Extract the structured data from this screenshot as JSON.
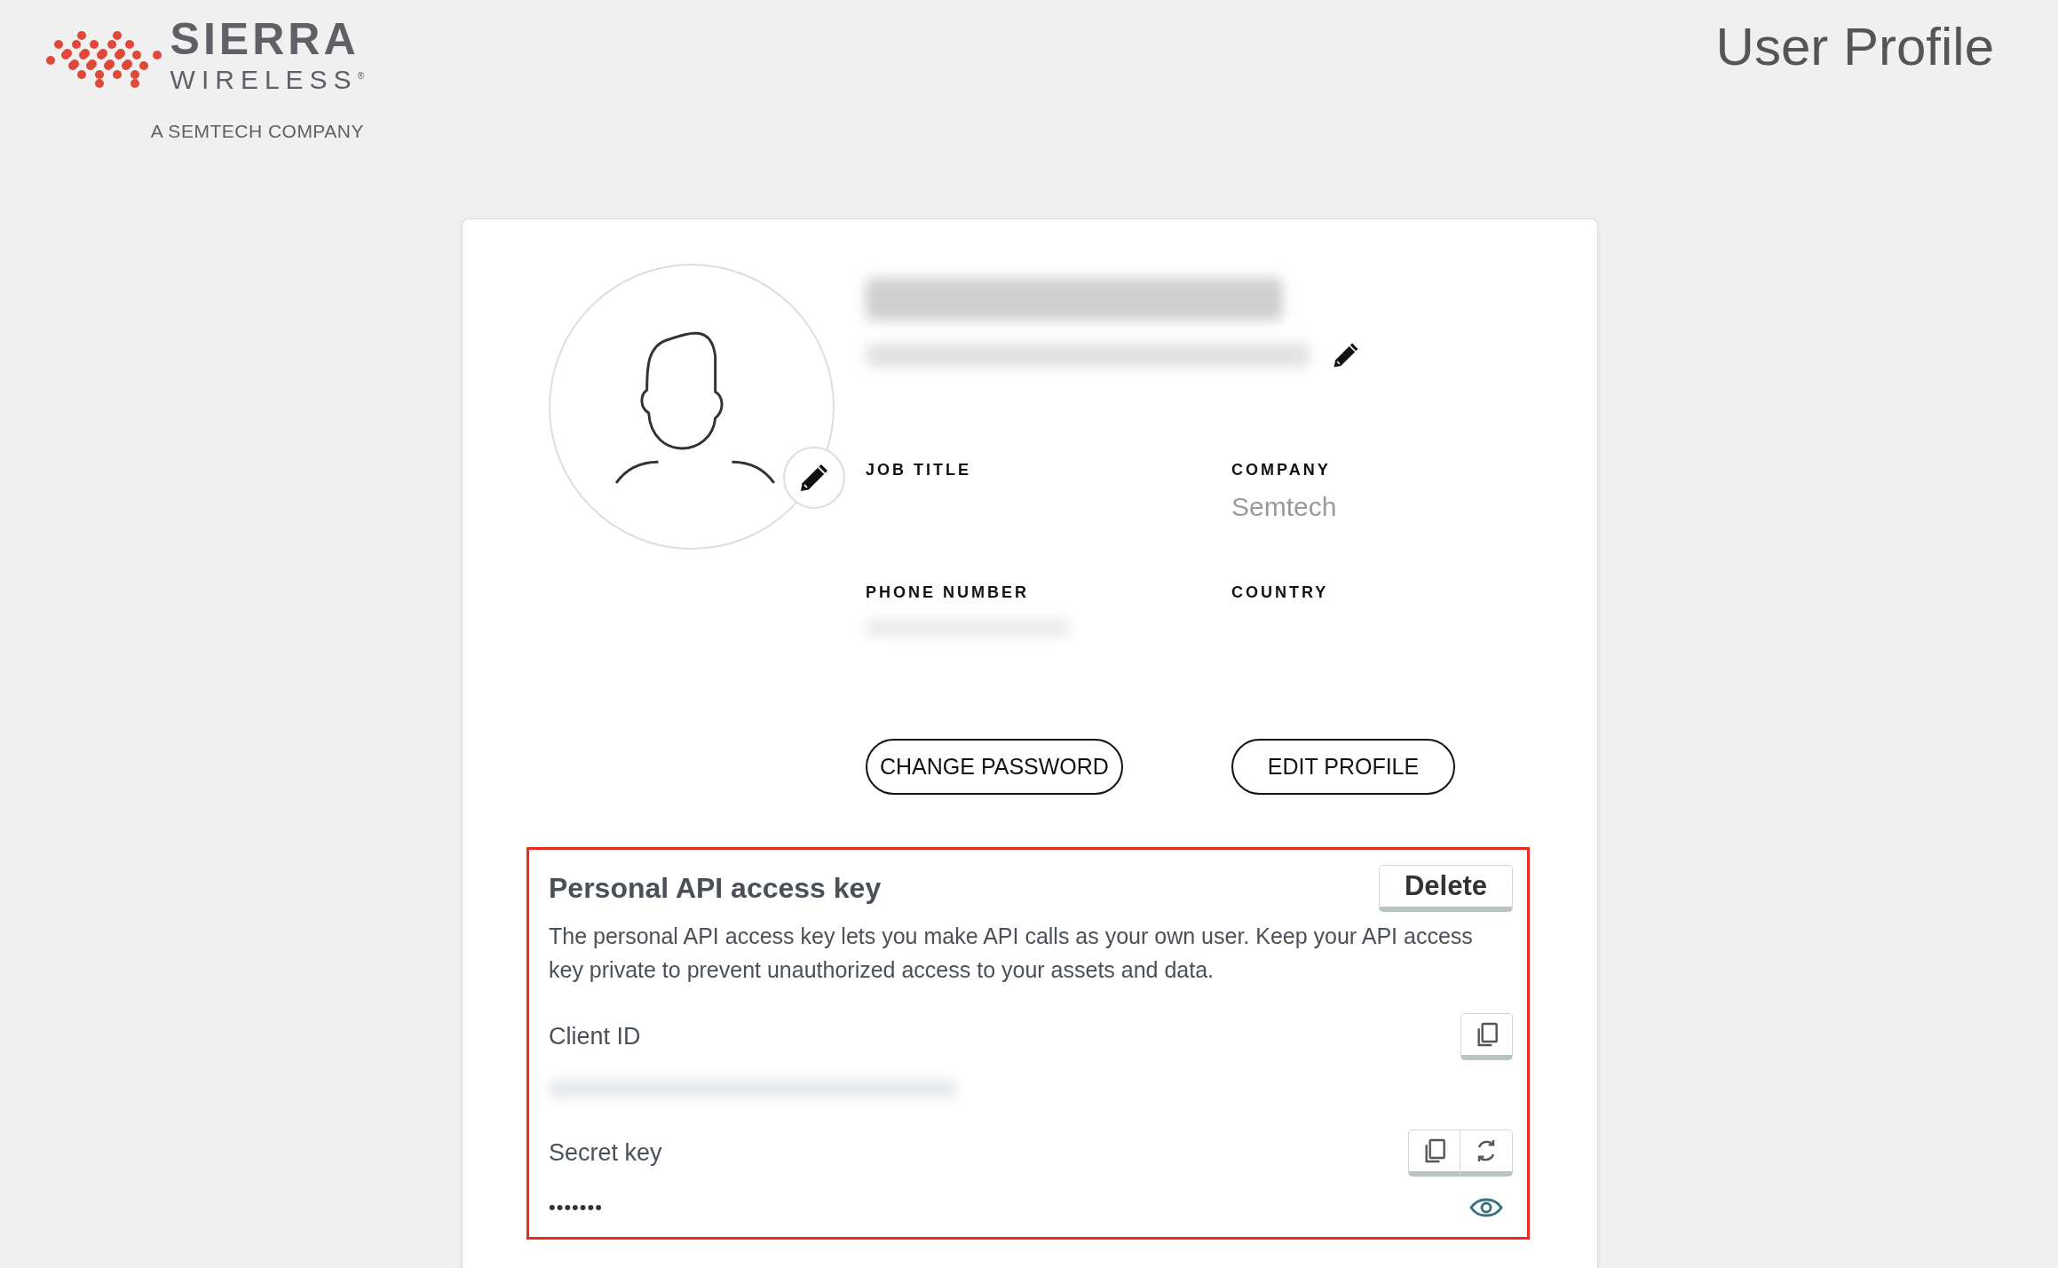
{
  "logo": {
    "name": "SIERRA",
    "subname": "WIRELESS$^{®}$",
    "tagline": "A SEMTECH COMPANY"
  },
  "page_title": "User Profile",
  "profile": {
    "fields": [
      {
        "label": "JOB TITLE",
        "blurred": false
      },
      {
        "label": "COMPANY",
        "value": "Semtech",
        "blurred": false
      },
      {
        "label": "PHONE NUMBER",
        "blurred": true
      },
      {
        "label": "COUNTRY",
        "blurred": false
      }
    ],
    "buttons": [
      "CHANGE PASSWORD",
      "EDIT PROFILE"
    ]
  },
  "api_key": {
    "title": "Personal API access key",
    "delete": "Delete",
    "description": "The personal API access key lets you make API calls as your own user. Keep your API access key private to prevent unauthorized access to your assets and data.",
    "client_id_label": "Client ID",
    "secret_label": "Secret key",
    "secret_value": "•••••••"
  }
}
